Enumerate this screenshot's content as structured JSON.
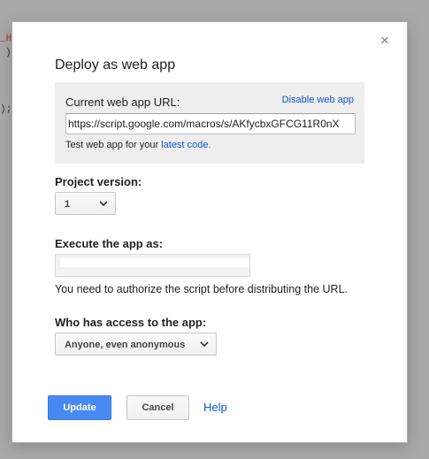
{
  "background": {
    "code_fragments": [
      "_H",
      ")",
      ");"
    ]
  },
  "dialog": {
    "title": "Deploy as web app",
    "close_symbol": "×",
    "url_section": {
      "label": "Current web app URL:",
      "disable_link": "Disable web app",
      "url_value": "https://script.google.com/macros/s/AKfycbxGFCG11R0nX",
      "test_text": "Test web app for your ",
      "test_link": "latest code."
    },
    "project_version": {
      "label": "Project version:",
      "selected": "1"
    },
    "execute_as": {
      "label": "Execute the app as:",
      "value": "",
      "note": "You need to authorize the script before distributing the URL."
    },
    "access": {
      "label": "Who has access to the app:",
      "selected": "Anyone, even anonymous"
    },
    "buttons": {
      "update": "Update",
      "cancel": "Cancel",
      "help": "Help"
    }
  },
  "colors": {
    "primary_button": "#4889f1",
    "link": "#1155cc",
    "url_box_bg": "#eeeeee"
  }
}
